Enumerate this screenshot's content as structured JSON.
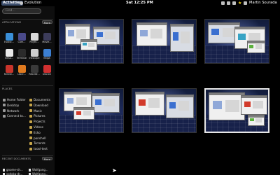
{
  "topbar": {
    "activities": "Activities",
    "app_name": "Evolution",
    "clock": "Sat 12:25 PM",
    "user": "Martin Sourada",
    "tray_star": "★"
  },
  "sidebar": {
    "search_placeholder": "Find...",
    "applications_title": "APPLICATIONS",
    "more_label": "More",
    "apps": [
      {
        "label": "Evolut...",
        "color": "#3a8fd8"
      },
      {
        "label": "Com...",
        "color": "#4a4a8a"
      },
      {
        "label": "Rhyth...",
        "color": "#d9d9d9"
      },
      {
        "label": "Movie...",
        "color": "#3c3c5a"
      },
      {
        "label": "Inkso...",
        "color": "#e8e8e8"
      },
      {
        "label": "Terminal",
        "color": "#2b2b2b"
      },
      {
        "label": "Inkscape",
        "color": "#cfcfcf"
      },
      {
        "label": "Ekiga",
        "color": "#3c7fd1"
      },
      {
        "label": "KOrele...",
        "color": "#c8342b"
      },
      {
        "label": "Libre...",
        "color": "#e07a1f"
      },
      {
        "label": "Rite-Wr...",
        "color": "#3a3a3a"
      },
      {
        "label": "Decree",
        "color": "#d03030"
      }
    ],
    "places_title": "PLACES",
    "places_left": [
      "Home Folder",
      "Desktop",
      "Network",
      "Connect to..."
    ],
    "places_right": [
      "Documents",
      "Download",
      "Music",
      "Pictures",
      "Projects",
      "Videos",
      "Ecko",
      "ponshell",
      "Torrents",
      "tooxl-test"
    ],
    "recent_title": "RECENT DOCUMENTS",
    "recent": [
      "gnome-sh...",
      "Wolfgang...",
      "sodoka-dr...",
      "Wolfgang...",
      "sodoka-dr...",
      "Wolfgang..."
    ]
  },
  "workspaces": [
    {
      "active": false
    },
    {
      "active": false
    },
    {
      "active": false
    },
    {
      "active": false
    },
    {
      "active": false
    },
    {
      "active": false
    },
    {
      "active": true
    }
  ]
}
